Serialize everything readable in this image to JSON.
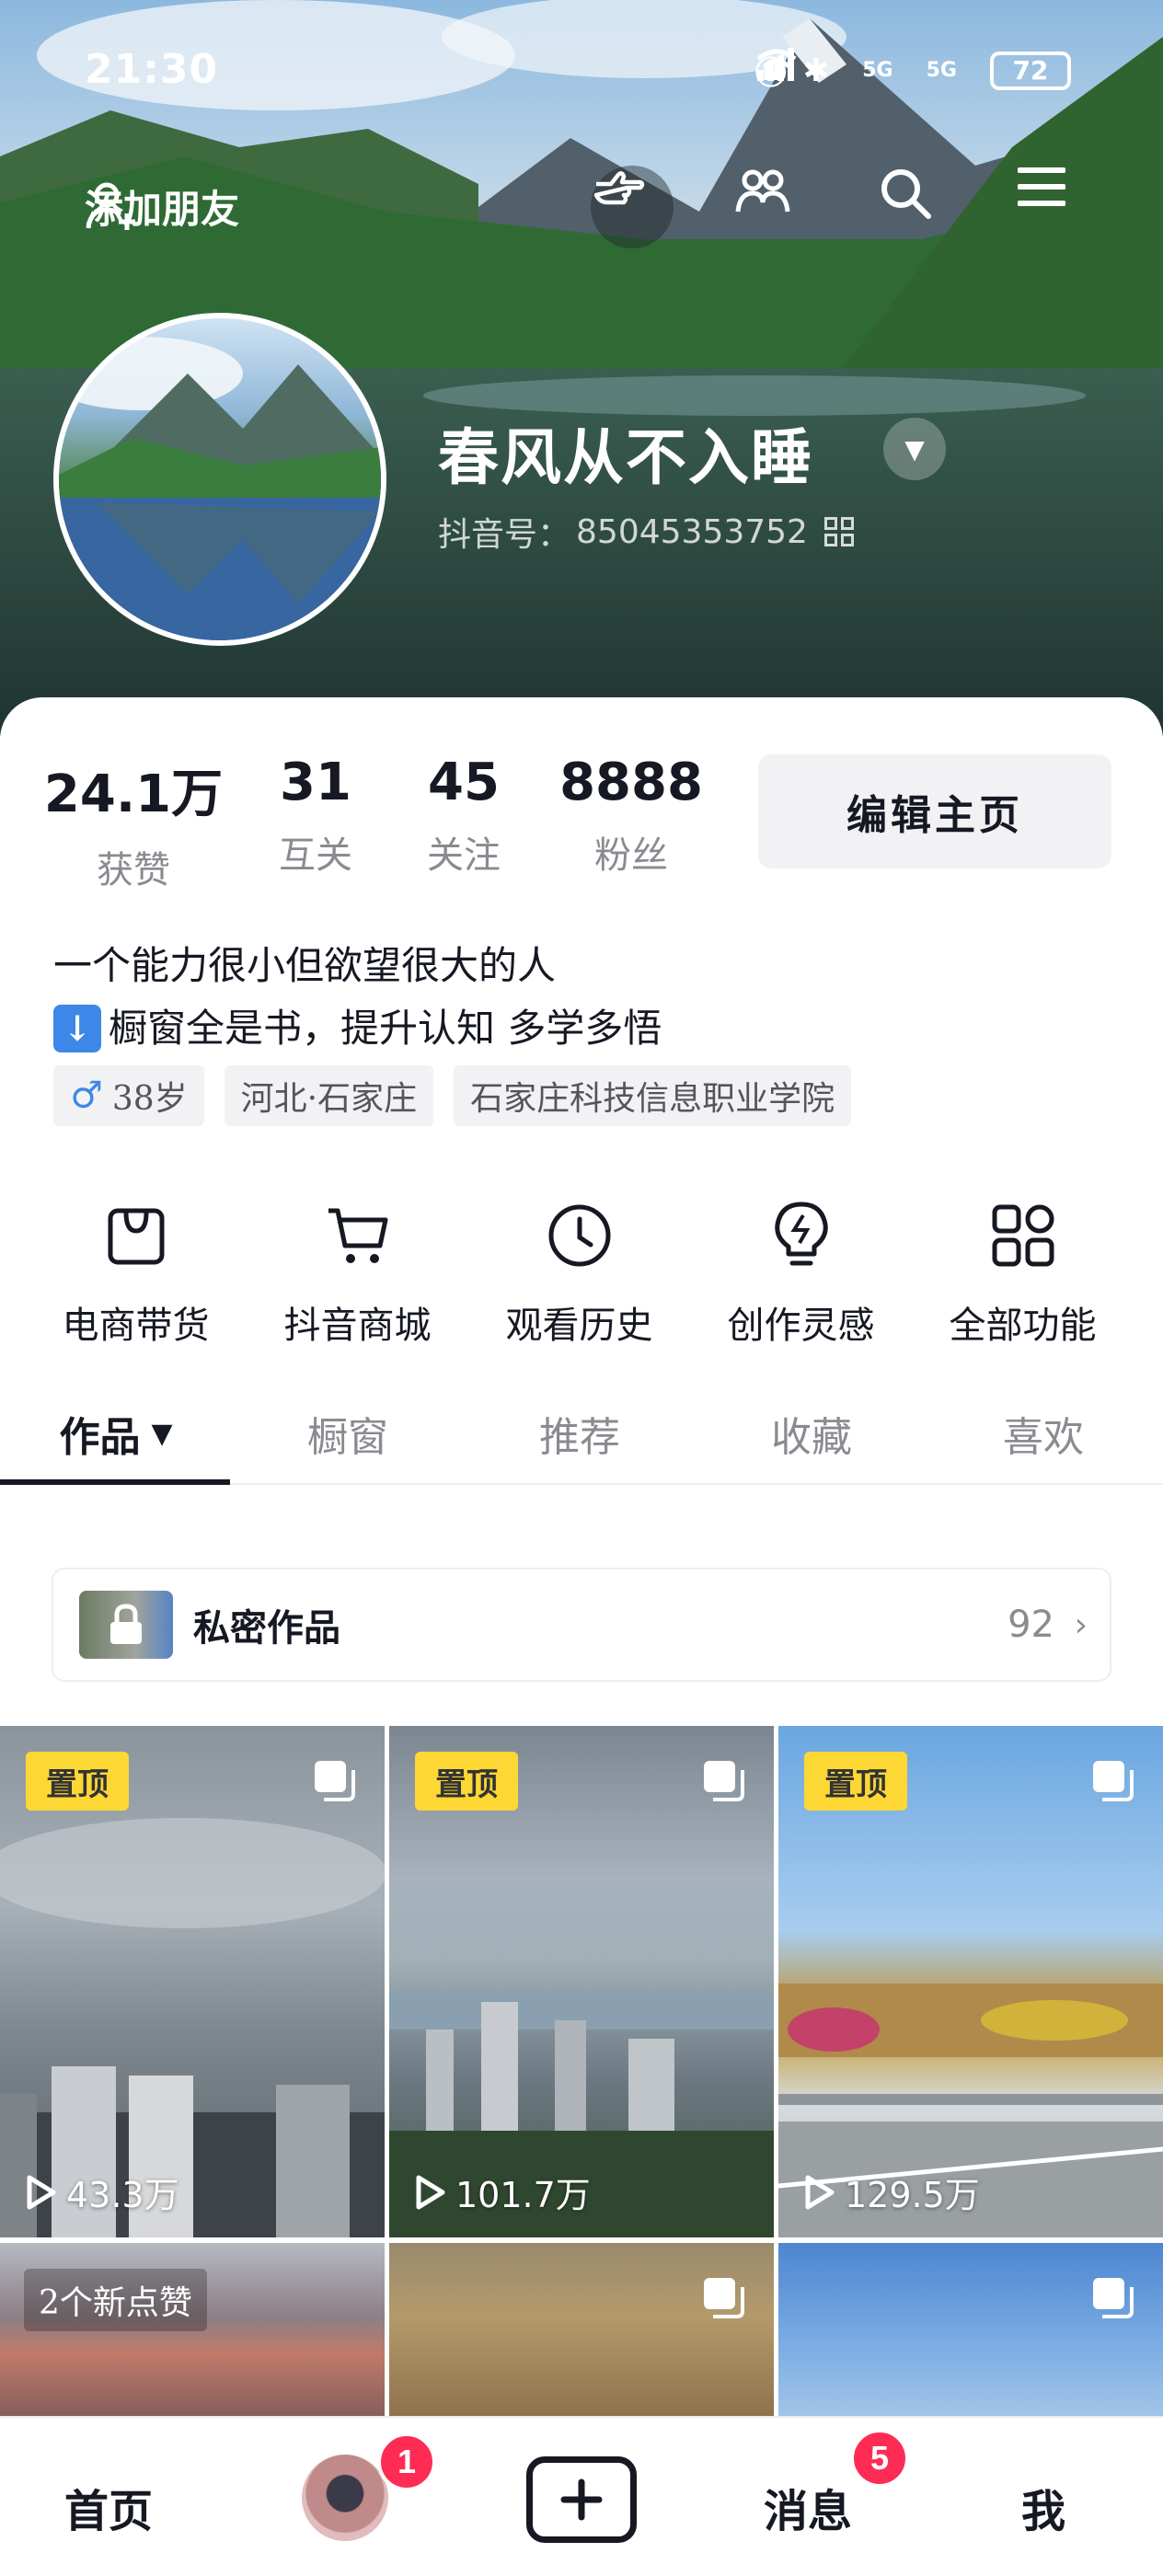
{
  "status_bar": {
    "time": "21:30",
    "battery": "72",
    "network_label_1": "5G",
    "network_label_2": "5G"
  },
  "top_nav": {
    "add_friend_label": "添加朋友",
    "icons": [
      "hand-point-icon",
      "friends-icon",
      "search-icon",
      "menu-icon"
    ]
  },
  "profile": {
    "nickname": "春风从不入睡",
    "douyin_id_label": "抖音号：",
    "douyin_id": "85045353752"
  },
  "stats": [
    {
      "value": "24.1万",
      "label": "获赞"
    },
    {
      "value": "31",
      "label": "互关"
    },
    {
      "value": "45",
      "label": "关注"
    },
    {
      "value": "8888",
      "label": "粉丝"
    }
  ],
  "edit_profile_label": "编辑主页",
  "bio": {
    "line1": "一个能力很小但欲望很大的人",
    "line2": "橱窗全是书，提升认知 多学多悟"
  },
  "tags": {
    "gender_age": "38岁",
    "location": "河北·石家庄",
    "school": "石家庄科技信息职业学院"
  },
  "tools": [
    {
      "label": "电商带货",
      "icon": "shopping-bag-icon"
    },
    {
      "label": "抖音商城",
      "icon": "cart-icon"
    },
    {
      "label": "观看历史",
      "icon": "clock-icon"
    },
    {
      "label": "创作灵感",
      "icon": "lightbulb-icon"
    },
    {
      "label": "全部功能",
      "icon": "grid-apps-icon"
    }
  ],
  "tabs": [
    {
      "label": "作品",
      "active": true
    },
    {
      "label": "橱窗"
    },
    {
      "label": "推荐"
    },
    {
      "label": "收藏"
    },
    {
      "label": "喜欢"
    }
  ],
  "private_works": {
    "label": "私密作品",
    "count": "92"
  },
  "videos": [
    {
      "pinned_label": "置顶",
      "plays": "43.3万"
    },
    {
      "pinned_label": "置顶",
      "plays": "101.7万"
    },
    {
      "pinned_label": "置顶",
      "plays": "129.5万"
    },
    {
      "likes_text": "2个新点赞"
    },
    {},
    {}
  ],
  "bottom_nav": {
    "home": "首页",
    "friends_badge": "1",
    "messages": "消息",
    "messages_badge": "5",
    "me": "我"
  },
  "colors": {
    "accent_red": "#fe2c55",
    "pin_yellow": "#fdd835",
    "text_dark": "#161823",
    "text_gray": "#8a8b91"
  }
}
